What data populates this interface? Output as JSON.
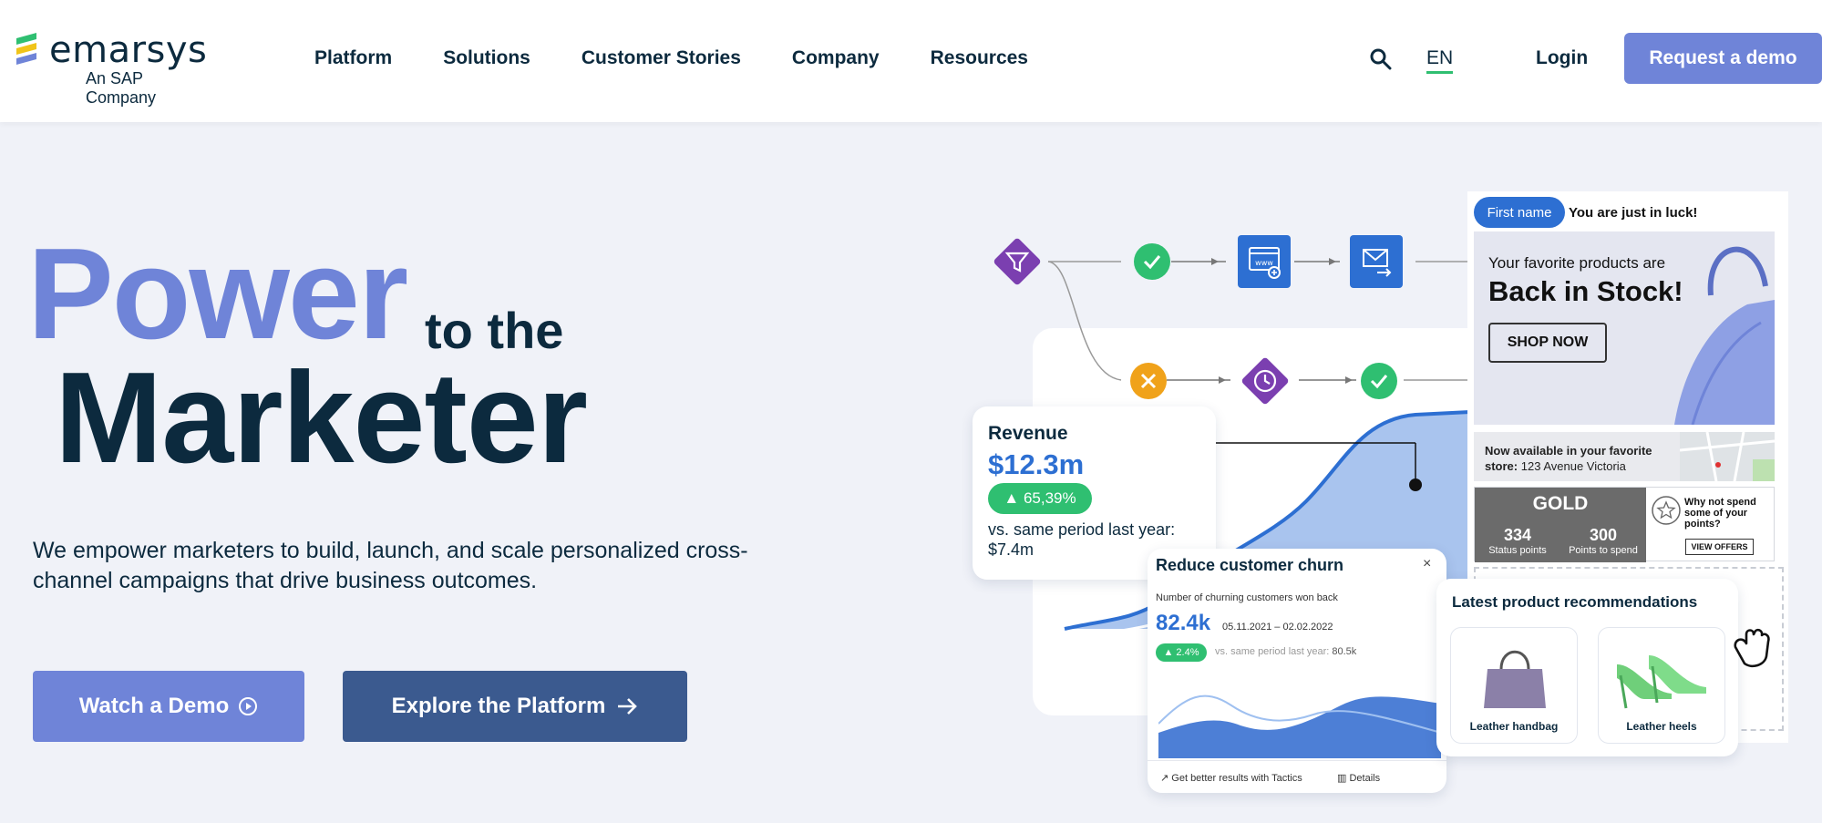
{
  "brand": {
    "name": "emarsys",
    "sub": "An SAP Company"
  },
  "nav": {
    "items": [
      "Platform",
      "Solutions",
      "Customer Stories",
      "Company",
      "Resources"
    ]
  },
  "header": {
    "lang": "EN",
    "login": "Login",
    "demo": "Request a demo"
  },
  "hero": {
    "power": "Power",
    "tothe": "to the",
    "marketer": "Marketer",
    "sub": "We empower marketers to build, launch, and scale personalized cross-channel campaigns that drive business outcomes.",
    "watch": "Watch a Demo",
    "explore": "Explore the Platform"
  },
  "revenue": {
    "title": "Revenue",
    "value": "$12.3m",
    "badge": "▲ 65,39%",
    "vs": "vs. same period last year: $7.4m"
  },
  "churn": {
    "title": "Reduce customer churn",
    "close": "×",
    "label": "Number of churning customers won back",
    "value": "82.4k",
    "dates": "05.11.2021 – 02.02.2022",
    "badge": "▲ 2.4%",
    "vs_prefix": "vs. same period last year: ",
    "vs_value": "80.5k",
    "foot_left": "Get better results with Tactics",
    "foot_right": "Details"
  },
  "recommendations": {
    "title": "Latest product recommendations",
    "item1": "Leather handbag",
    "item2": "Leather heels"
  },
  "email": {
    "chip": "First name",
    "greeting": "You are just in luck!",
    "line1": "Your favorite products are",
    "line2": "Back in Stock!",
    "shop": "SHOP NOW",
    "store_bold": "Now available in your favorite store:",
    "store_addr": " 123 Avenue Victoria",
    "gold": "GOLD",
    "status_n": "334",
    "status_t": "Status points",
    "spend_n": "300",
    "spend_t": "Points to spend",
    "offers_text": "Why not spend some of your points?",
    "offers_btn": "VIEW OFFERS"
  },
  "colors": {
    "accent": "#6f84d8",
    "navy": "#0c2a3e",
    "green": "#2fbf71",
    "blue": "#2d6fd2",
    "purple": "#7b3fb0",
    "orange": "#f0a21a"
  }
}
